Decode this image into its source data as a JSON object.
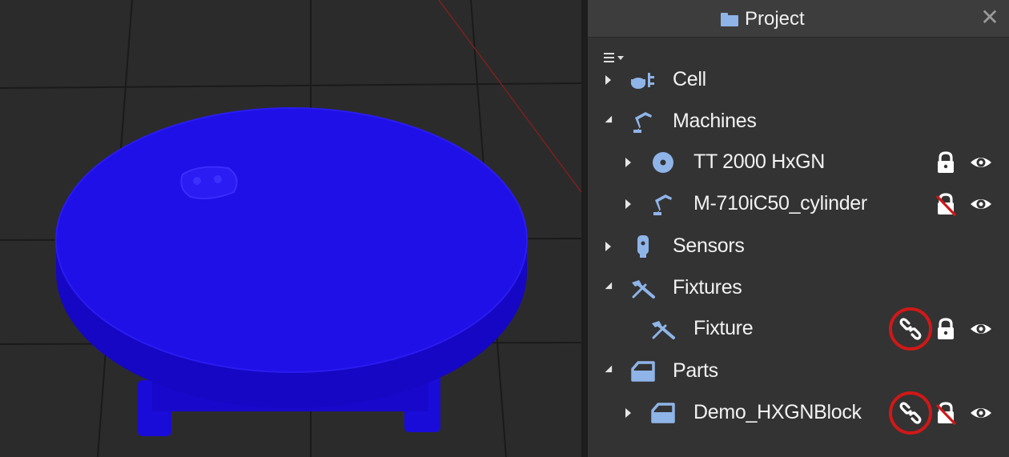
{
  "panel": {
    "title": "Project",
    "title_icon": "folder-icon",
    "close_icon": "close-icon",
    "close_glyph": "✕",
    "menu_icon": "hamburger-menu-icon"
  },
  "tree": [
    {
      "id": "cell",
      "label": "Cell",
      "icon": "cell-icon",
      "level": 0,
      "expanded": false,
      "link": false,
      "lock": "none",
      "visible": false
    },
    {
      "id": "machines",
      "label": "Machines",
      "icon": "robot-arm-icon",
      "level": 0,
      "expanded": true,
      "link": false,
      "lock": "none",
      "visible": false
    },
    {
      "id": "tt2000",
      "label": "TT 2000 HxGN",
      "icon": "turntable-icon",
      "level": 1,
      "expanded": false,
      "link": false,
      "lock": "locked",
      "visible": true
    },
    {
      "id": "m710",
      "label": "M-710iC50_cylinder",
      "icon": "robot-arm-icon",
      "level": 1,
      "expanded": false,
      "link": false,
      "lock": "unlocked",
      "visible": true
    },
    {
      "id": "sensors",
      "label": "Sensors",
      "icon": "sensor-icon",
      "level": 0,
      "expanded": false,
      "link": false,
      "lock": "none",
      "visible": false
    },
    {
      "id": "fixtures",
      "label": "Fixtures",
      "icon": "fixture-icon",
      "level": 0,
      "expanded": true,
      "link": false,
      "lock": "none",
      "visible": false
    },
    {
      "id": "fixture",
      "label": "Fixture",
      "icon": "fixture-icon",
      "level": 1,
      "expanded": null,
      "link": true,
      "lock": "locked",
      "visible": true
    },
    {
      "id": "parts",
      "label": "Parts",
      "icon": "part-icon",
      "level": 0,
      "expanded": true,
      "link": false,
      "lock": "none",
      "visible": false
    },
    {
      "id": "demo",
      "label": "Demo_HXGNBlock",
      "icon": "part-icon",
      "level": 1,
      "expanded": false,
      "link": true,
      "lock": "unlocked",
      "visible": true
    }
  ],
  "colors": {
    "panel_bg": "#333333",
    "icon_blue": "#8fb4e8",
    "model_blue": "#1f10e8",
    "annotation_red": "#d01818",
    "grid_line": "#1c1c1c"
  }
}
